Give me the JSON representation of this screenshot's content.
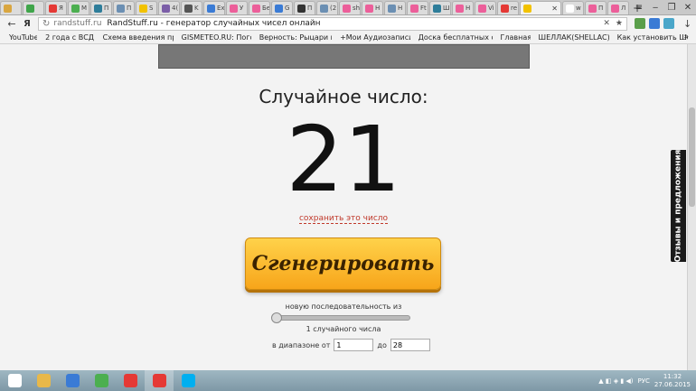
{
  "browser": {
    "tabs": [
      {
        "label": "",
        "color": "#d9a640"
      },
      {
        "label": "",
        "color": "#3fa54a"
      },
      {
        "label": "Я",
        "color": "#e53935"
      },
      {
        "label": "M",
        "color": "#4caf50"
      },
      {
        "label": "П",
        "color": "#2e7d9a"
      },
      {
        "label": "П",
        "color": "#6b8fb3"
      },
      {
        "label": "S",
        "color": "#f2c200"
      },
      {
        "label": "4(",
        "color": "#7b5ea7"
      },
      {
        "label": "K",
        "color": "#555555"
      },
      {
        "label": "Ex",
        "color": "#3a7bd5"
      },
      {
        "label": "У",
        "color": "#ec5f9a"
      },
      {
        "label": "Бе",
        "color": "#ec5f9a"
      },
      {
        "label": "G",
        "color": "#3a7bd5"
      },
      {
        "label": "П",
        "color": "#333333"
      },
      {
        "label": "(2",
        "color": "#6b8fb3"
      },
      {
        "label": "sh",
        "color": "#ec5f9a"
      },
      {
        "label": "H",
        "color": "#ec5f9a"
      },
      {
        "label": "H",
        "color": "#6b8fb3"
      },
      {
        "label": "Ft",
        "color": "#ec5f9a"
      },
      {
        "label": "Ш",
        "color": "#2e7d9a"
      },
      {
        "label": "H",
        "color": "#ec5f9a"
      },
      {
        "label": "Vi",
        "color": "#ec5f9a"
      },
      {
        "label": "re",
        "color": "#e53935"
      },
      {
        "label": "",
        "color": "#f2c200",
        "active": true
      },
      {
        "label": "w",
        "color": "#ffffff"
      },
      {
        "label": "П",
        "color": "#ec5f9a"
      },
      {
        "label": "Л",
        "color": "#ec5f9a"
      }
    ],
    "new_tab_label": "+",
    "back": "←",
    "yandex_btn": "Я",
    "address": {
      "reload": "↻",
      "domain": "randstuff.ru",
      "page_title": "RandStuff.ru - генератор случайных чисел онлайн",
      "close_glyph": "✕",
      "star_glyph": "★"
    },
    "download_glyph": "↓",
    "menu_glyph": "≡",
    "window_controls": {
      "minimize": "‒",
      "restore": "❐",
      "close": "✕"
    }
  },
  "bookmarks": {
    "items": [
      "YouTube",
      "2 года с ВСД!",
      "Схема введения пр",
      "GISMETEO.RU: Пого",
      "Верность: Рыцари и",
      "+Мои Аудиозаписи",
      "Доска бесплатных о",
      "Главная",
      "ШЕЛЛАК(SHELLAC).",
      "Как установить Ше"
    ],
    "more": "»"
  },
  "page": {
    "random_label": "Случайное число:",
    "random_number": "21",
    "save_link": "сохранить это число",
    "generate_button": "Сгенерировать",
    "sequence_label": "новую последовательность из",
    "slider_value": 1,
    "count_label": "1 случайного числа",
    "range_from_label": "в диапазоне от",
    "range_from_value": "1",
    "range_to_label": "до",
    "range_to_value": "28",
    "feedback_tab": "Отзывы и предложения"
  },
  "taskbar": {
    "apps": [
      {
        "name": "start",
        "color": "#ffffff"
      },
      {
        "name": "explorer",
        "color": "#e8b84a"
      },
      {
        "name": "media",
        "color": "#3a7bd5"
      },
      {
        "name": "chrome",
        "color": "#4caf50"
      },
      {
        "name": "yandex",
        "color": "#e53935"
      },
      {
        "name": "yandex-browser",
        "color": "#e53935",
        "active": true
      },
      {
        "name": "skype",
        "color": "#00aff0"
      }
    ],
    "tray_lang": "РУС",
    "time": "11:32",
    "date": "27.06.2015"
  }
}
